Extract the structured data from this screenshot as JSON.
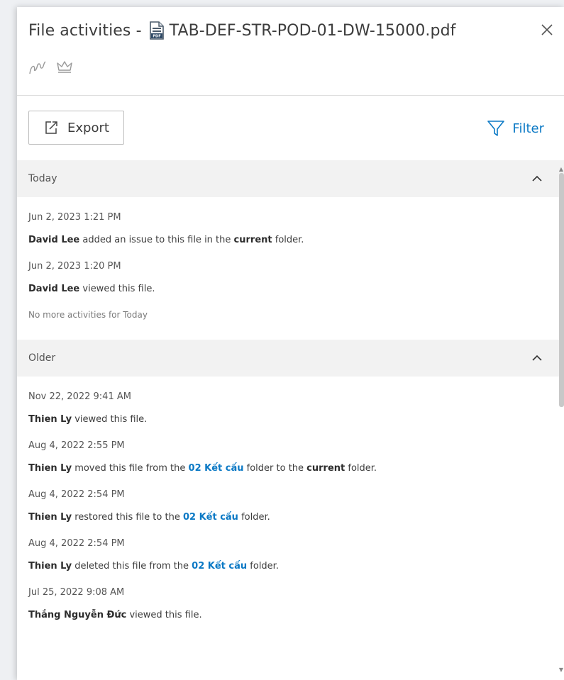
{
  "header": {
    "title_prefix": "File activities - ",
    "file_name": "TAB-DEF-STR-POD-01-DW-15000.pdf",
    "file_icon": "pdf-file-icon",
    "pdf_badge": "PDF",
    "close_icon": "close-icon",
    "tag_icons": [
      "markup-icon",
      "crown-icon"
    ]
  },
  "toolbar": {
    "export_label": "Export",
    "export_icon": "export-icon",
    "filter_label": "Filter",
    "filter_icon": "filter-icon"
  },
  "colors": {
    "accent": "#0b79c5",
    "section_bg": "#f2f2f2",
    "text": "#3c3c3c"
  },
  "sections": [
    {
      "title": "Today",
      "activities": [
        {
          "time": "Jun 2, 2023 1:21 PM",
          "user": "David Lee",
          "t1": " added an issue to this file in the ",
          "f1": "current",
          "t2": " folder.",
          "f2": "",
          "t3": ""
        },
        {
          "time": "Jun 2, 2023 1:20 PM",
          "user": "David Lee",
          "t1": " viewed this file.",
          "f1": "",
          "t2": "",
          "f2": "",
          "t3": ""
        }
      ],
      "footer": "No more activities for Today"
    },
    {
      "title": "Older",
      "activities": [
        {
          "time": "Nov 22, 2022 9:41 AM",
          "user": "Thien Ly",
          "t1": " viewed this file.",
          "f1": "",
          "t2": "",
          "f2": "",
          "t3": ""
        },
        {
          "time": "Aug 4, 2022 2:55 PM",
          "user": "Thien Ly",
          "t1": " moved this file from the ",
          "f1": "02 Kết cấu",
          "t2": " folder to the ",
          "f2": "current",
          "t3": " folder."
        },
        {
          "time": "Aug 4, 2022 2:54 PM",
          "user": "Thien Ly",
          "t1": " restored this file to the ",
          "f1": "02 Kết cấu",
          "t2": " folder.",
          "f2": "",
          "t3": ""
        },
        {
          "time": "Aug 4, 2022 2:54 PM",
          "user": "Thien Ly",
          "t1": " deleted this file from the ",
          "f1": "02 Kết cấu",
          "t2": " folder.",
          "f2": "",
          "t3": ""
        },
        {
          "time": "Jul 25, 2022 9:08 AM",
          "user": "Thắng Nguyễn Đức",
          "t1": " viewed this file.",
          "f1": "",
          "t2": "",
          "f2": "",
          "t3": ""
        }
      ],
      "footer": ""
    }
  ]
}
